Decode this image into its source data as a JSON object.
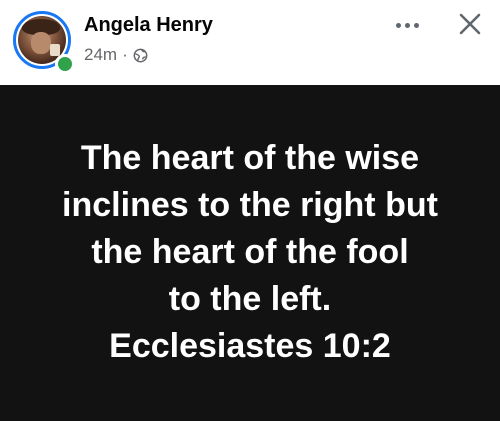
{
  "post": {
    "author_name": "Angela Henry",
    "timestamp": "24m",
    "separator": "·",
    "privacy_icon": "globe-icon",
    "body_text": "The heart of the wise\ninclines to the right but\nthe heart of the fool\nto the left.\nEcclesiastes 10:2"
  },
  "icons": {
    "more": "more-options-icon",
    "close": "close-icon",
    "status": "online-status-dot"
  },
  "colors": {
    "avatar_ring": "#1877f2",
    "online": "#31a24c",
    "image_background": "#121212",
    "text_on_image": "#ffffff"
  }
}
